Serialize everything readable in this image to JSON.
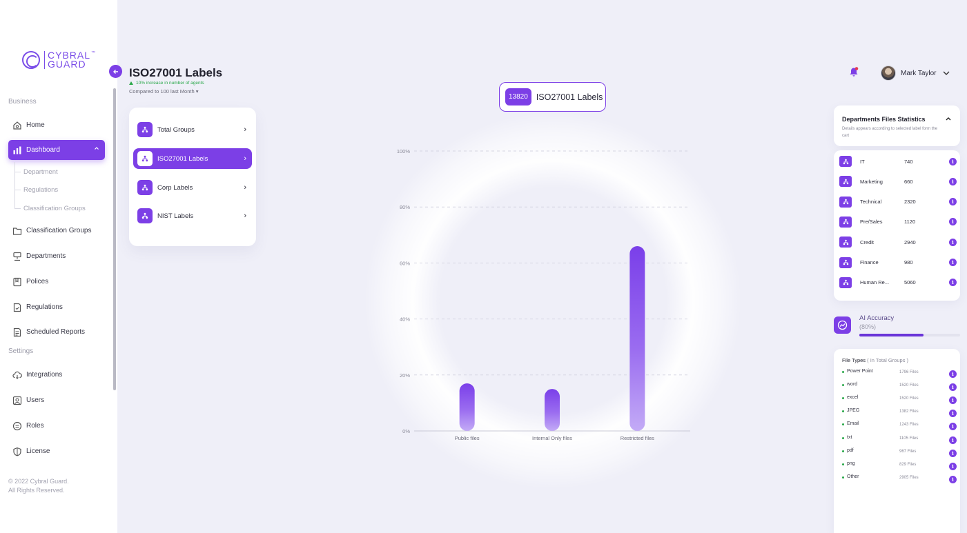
{
  "brand": {
    "line1": "CYBRAL",
    "line2": "GUARD",
    "tm": "™"
  },
  "sidebar": {
    "section_business": "Business",
    "section_settings": "Settings",
    "home": "Home",
    "dashboard": "Dashboard",
    "dashboard_sub": [
      "Department",
      "Regulations",
      "Classification Groups"
    ],
    "classification_groups": "Classification Groups",
    "departments": "Departments",
    "polices": "Polices",
    "regulations": "Regulations",
    "scheduled_reports": "Scheduled Reports",
    "integrations": "Integrations",
    "users": "Users",
    "roles": "Roles",
    "license": "License",
    "copyright_1": "© 2022 Cybral Guard.",
    "copyright_2": "All Rights Reserved."
  },
  "header": {
    "title": "ISO27001 Labels",
    "increase": "10% increase in number of agents",
    "compared": "Compared to 100 last Month",
    "user_name": "Mark Taylor"
  },
  "label_menu": [
    {
      "label": "Total Groups"
    },
    {
      "label": "ISO27001 Labels",
      "active": true
    },
    {
      "label": "Corp Labels"
    },
    {
      "label": "NIST Labels"
    }
  ],
  "chart_badge": {
    "count": "13820",
    "label": "ISO27001 Labels"
  },
  "chart_data": {
    "type": "bar",
    "categories": [
      "Public files",
      "Internal Only files",
      "Restricted files"
    ],
    "values": [
      17,
      15,
      66
    ],
    "ylim": [
      0,
      100
    ],
    "yticks": [
      "0%",
      "20%",
      "40%",
      "60%",
      "80%",
      "100%"
    ],
    "grid": true,
    "xlabel": "",
    "ylabel": ""
  },
  "dept_stats": {
    "title": "Departments Files Statistics",
    "subtitle": "Details appears according to selected label form the cart",
    "rows": [
      {
        "name": "IT",
        "value": "740"
      },
      {
        "name": "Marketing",
        "value": "660"
      },
      {
        "name": "Technical",
        "value": "2320"
      },
      {
        "name": "Pre/Sales",
        "value": "1120"
      },
      {
        "name": "Credit",
        "value": "2940"
      },
      {
        "name": "Finance",
        "value": "980"
      },
      {
        "name": "Human Re...",
        "value": "5060"
      }
    ]
  },
  "ai_accuracy": {
    "title": "AI Accuracy",
    "percent_text": "(80%)",
    "value": 0.8
  },
  "file_types": {
    "title": "File Types",
    "title_muted": "( In Total Groups )",
    "rows": [
      {
        "name": "Power Point",
        "value": "1796 Files"
      },
      {
        "name": "word",
        "value": "1520 Files"
      },
      {
        "name": "excel",
        "value": "1520 Files"
      },
      {
        "name": "JPEG",
        "value": "1382 Files"
      },
      {
        "name": "Email",
        "value": "1243 Files"
      },
      {
        "name": "txt",
        "value": "1105 Files"
      },
      {
        "name": "pdf",
        "value": "967 Files"
      },
      {
        "name": "png",
        "value": "829 Files"
      },
      {
        "name": "Other",
        "value": "2905 Files"
      }
    ]
  },
  "colors": {
    "accent": "#7c3fe6",
    "positive": "#2aa84a",
    "background": "#efeff8"
  }
}
